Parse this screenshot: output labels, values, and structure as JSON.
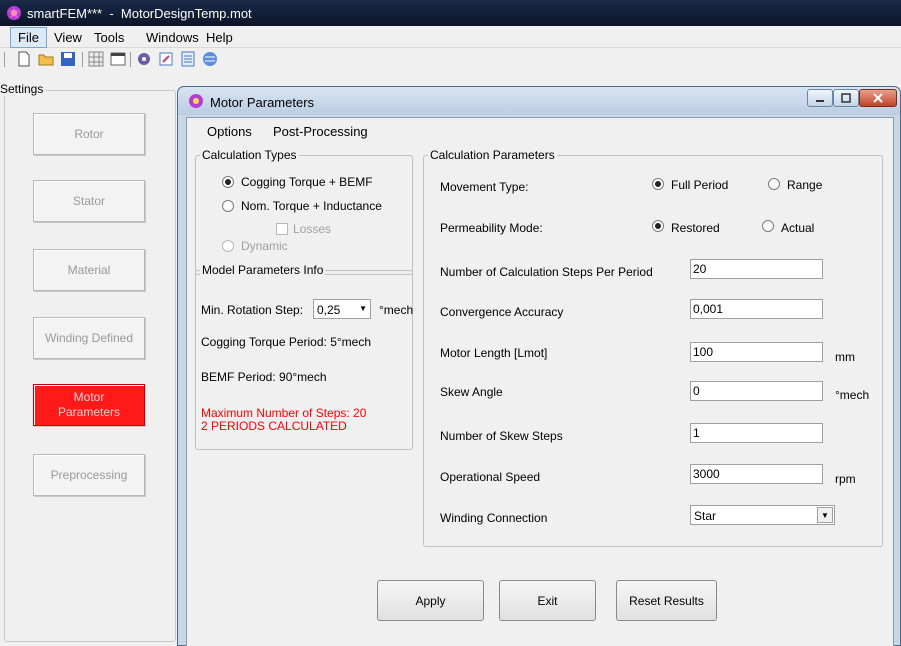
{
  "app": {
    "title": "smartFEM***  -  MotorDesignTemp.mot"
  },
  "menubar": {
    "items": [
      "File",
      "View",
      "Tools",
      "Windows",
      "Help"
    ]
  },
  "toolbar": {
    "icons": [
      "new-file-icon",
      "open-folder-icon",
      "save-icon",
      "grid-icon",
      "table-icon",
      "gear-icon",
      "edit-icon",
      "list-icon",
      "globe-icon"
    ]
  },
  "settings": {
    "label": "Settings",
    "buttons": [
      "Rotor",
      "Stator",
      "Material",
      "Winding Defined",
      "Motor\nParameters",
      "Preprocessing"
    ],
    "active_color": "#ff1a1a"
  },
  "dialog": {
    "title": "Motor Parameters",
    "menu": [
      "Options",
      "Post-Processing"
    ],
    "calc_types": {
      "label": "Calculation Types",
      "cogging": "Cogging Torque + BEMF",
      "nominal": "Nom. Torque + Inductance",
      "losses": "Losses",
      "dynamic": "Dynamic"
    },
    "model_info": {
      "label": "Model Parameters Info",
      "min_rot_label": "Min. Rotation Step:",
      "min_rot_value": "0,25",
      "min_rot_unit": "°mech",
      "cogging_period": "Cogging Torque Period: 5°mech",
      "bemf_period": "BEMF Period: 90°mech",
      "max_steps": "Maximum Number of Steps: 20",
      "periods_calc": "2 PERIODS CALCULATED"
    },
    "calc_params": {
      "label": "Calculation Parameters",
      "movement_type": "Movement Type:",
      "full_period": "Full Period",
      "range": "Range",
      "perm_mode": "Permeability Mode:",
      "restored": "Restored",
      "actual": "Actual",
      "steps_label": "Number of Calculation Steps Per Period",
      "steps_value": "20",
      "conv_label": "Convergence Accuracy",
      "conv_value": "0,001",
      "len_label": "Motor Length [Lmot]",
      "len_value": "100",
      "len_unit": "mm",
      "skew_label": "Skew Angle",
      "skew_value": "0",
      "skew_unit": "°mech",
      "skew_steps_label": "Number of Skew Steps",
      "skew_steps_value": "1",
      "speed_label": "Operational Speed",
      "speed_value": "3000",
      "speed_unit": "rpm",
      "winding_label": "Winding Connection",
      "winding_value": "Star"
    },
    "buttons": {
      "apply": "Apply",
      "exit": "Exit",
      "reset": "Reset Results"
    }
  }
}
